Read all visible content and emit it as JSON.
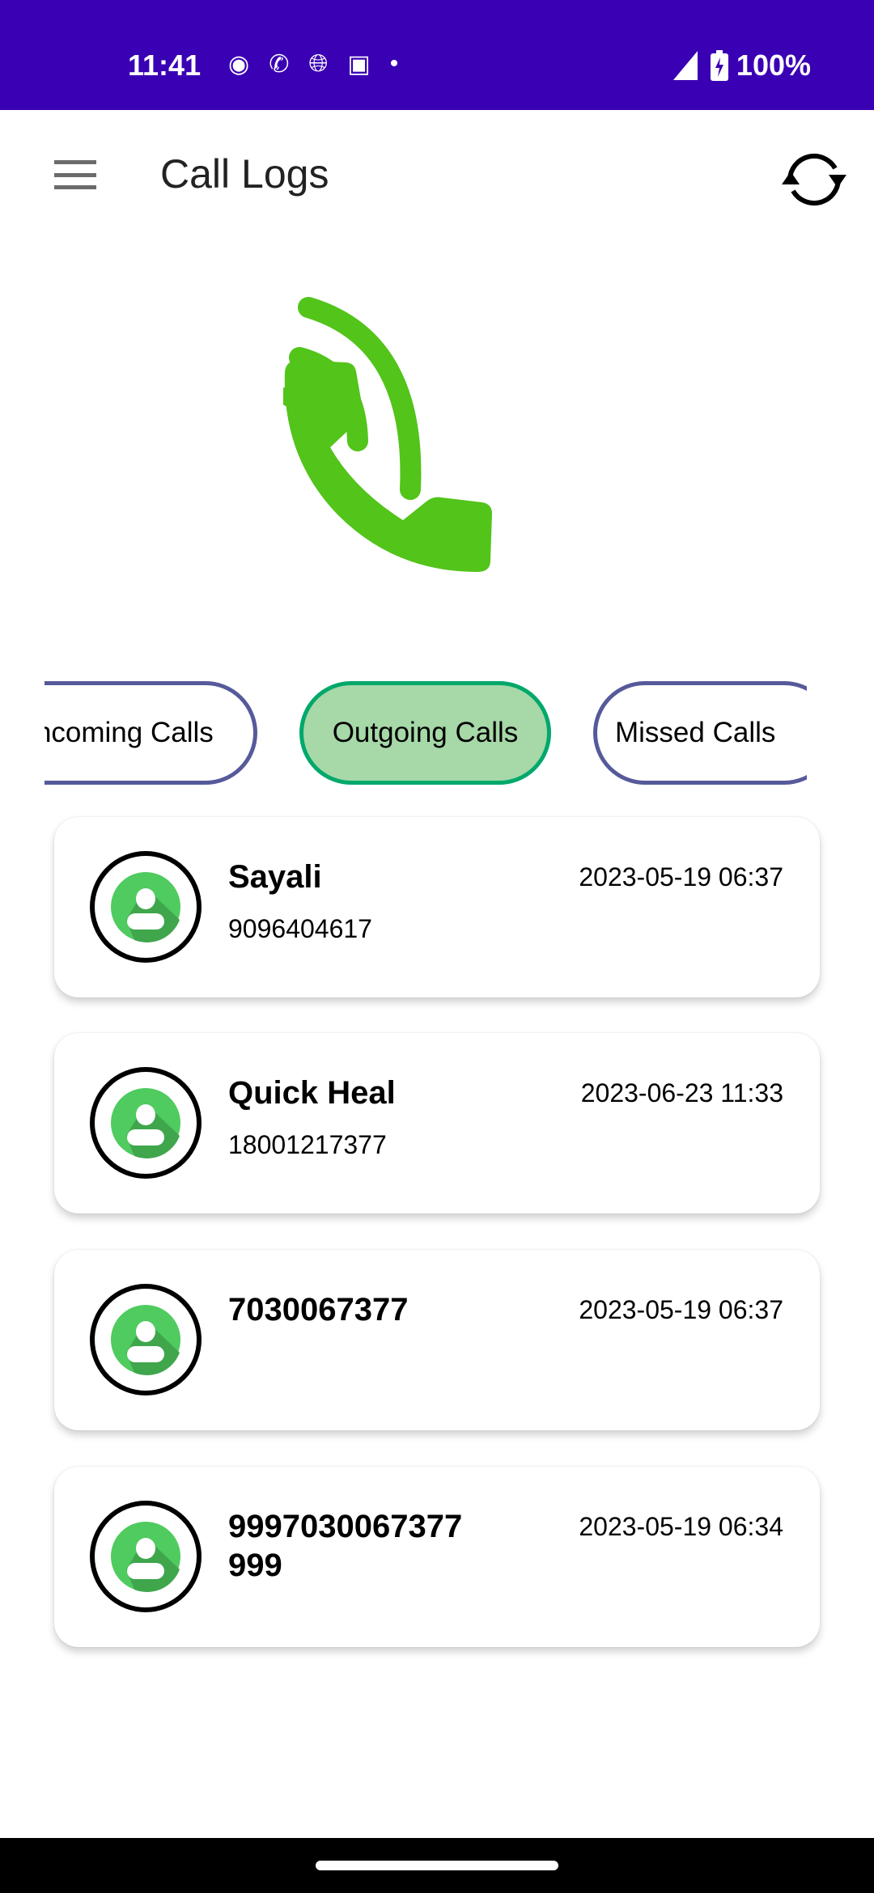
{
  "status_bar": {
    "time": "11:41",
    "battery": "100%",
    "notification_icons": [
      "zee5-icon",
      "whatsapp-icon",
      "vpn-globe-icon",
      "flipkart-icon",
      "dot-icon"
    ]
  },
  "toolbar": {
    "title": "Call Logs"
  },
  "tabs": [
    {
      "label": "Incoming Calls",
      "active": false
    },
    {
      "label": "Outgoing Calls",
      "active": true
    },
    {
      "label": "Missed Calls",
      "active": false
    }
  ],
  "calls": [
    {
      "name": "Sayali",
      "number": "9096404617",
      "date": "2023-05-19 06:37"
    },
    {
      "name": "Quick Heal",
      "number": "18001217377",
      "date": "2023-06-23 11:33"
    },
    {
      "name": "7030067377",
      "number": "",
      "date": "2023-05-19 06:37"
    },
    {
      "name": "9997030067377999",
      "number": "",
      "date": "2023-05-19 06:34"
    }
  ],
  "colors": {
    "status_bar": "#3a00b4",
    "accent_green": "#52c41a",
    "active_tab": "#a6d8a8",
    "tab_border": "#565a9a"
  }
}
